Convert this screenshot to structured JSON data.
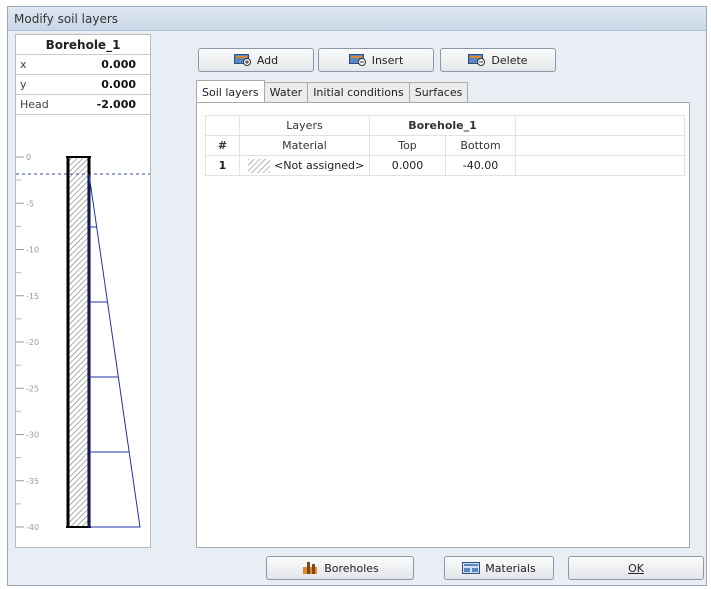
{
  "window": {
    "title": "Modify soil layers"
  },
  "borehole": {
    "name": "Borehole_1",
    "fields": [
      {
        "key": "x",
        "value": "0.000"
      },
      {
        "key": "y",
        "value": "0.000"
      },
      {
        "key": "Head",
        "value": "-2.000"
      }
    ],
    "depth_labels": [
      "0",
      "-5",
      "-10",
      "-15",
      "-20",
      "-25",
      "-30",
      "-35",
      "-40"
    ]
  },
  "toolbar": {
    "add": "Add",
    "insert": "Insert",
    "delete": "Delete"
  },
  "tabs": [
    "Soil layers",
    "Water",
    "Initial conditions",
    "Surfaces"
  ],
  "table": {
    "group_headers": {
      "layers": "Layers",
      "borehole": "Borehole_1"
    },
    "columns": {
      "num": "#",
      "material": "Material",
      "top": "Top",
      "bottom": "Bottom"
    },
    "rows": [
      {
        "num": "1",
        "material": "<Not assigned>",
        "top": "0.000",
        "bottom": "-40.00"
      }
    ]
  },
  "footer": {
    "boreholes": "Boreholes",
    "materials": "Materials",
    "ok": "OK"
  },
  "colors": {
    "accent": "#2233aa",
    "icon_blue": "#5b86c4",
    "icon_orange": "#e0892a"
  }
}
